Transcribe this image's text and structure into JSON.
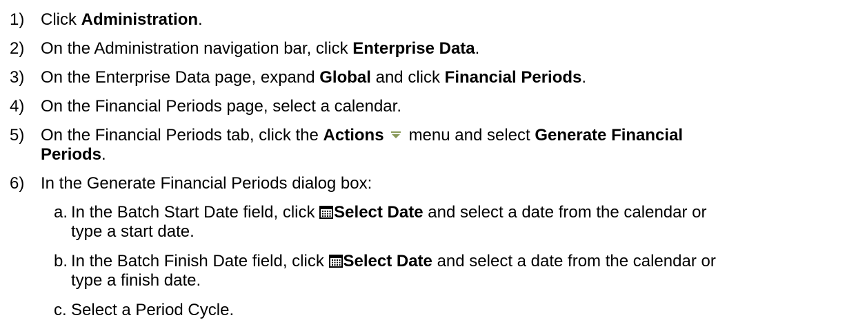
{
  "steps": [
    {
      "num": "1)",
      "pre": "Click ",
      "bold": "Administration",
      "post": "."
    },
    {
      "num": "2)",
      "pre": "On the Administration navigation bar, click ",
      "bold": "Enterprise Data",
      "post": "."
    },
    {
      "num": "3)",
      "pre": "On the Enterprise Data page, expand ",
      "bold1": "Global",
      "mid": " and click ",
      "bold2": "Financial Periods",
      "post": "."
    },
    {
      "num": "4)",
      "text": "On the Financial Periods page, select a calendar."
    },
    {
      "num": "5)",
      "pre": "On the Financial Periods tab, click the ",
      "bold1": "Actions",
      "mid": "menu and select ",
      "bold2_line1": "Generate Financial",
      "bold2_line2": "Periods",
      "post": "."
    },
    {
      "num": "6)",
      "text": "In the Generate Financial Periods dialog box:",
      "substeps": [
        {
          "letter": "a.",
          "pre": "In the Batch Start Date field, click ",
          "bold": "Select Date",
          "post_line1": " and select a date from the calendar or",
          "post_line2": "type a start date."
        },
        {
          "letter": "b.",
          "pre": "In the Batch Finish Date field, click ",
          "bold": "Select Date",
          "post_line1": " and select a date from the calendar or",
          "post_line2": "type a finish date."
        },
        {
          "letter": "c.",
          "text": "Select a Period Cycle."
        }
      ]
    }
  ],
  "icons": {
    "actions_menu": "dropdown-arrow-icon",
    "select_date": "calendar-icon"
  },
  "colors": {
    "text": "#000000",
    "dropdown_arrow": "#8a9a5b",
    "calendar_icon": "#000000"
  }
}
